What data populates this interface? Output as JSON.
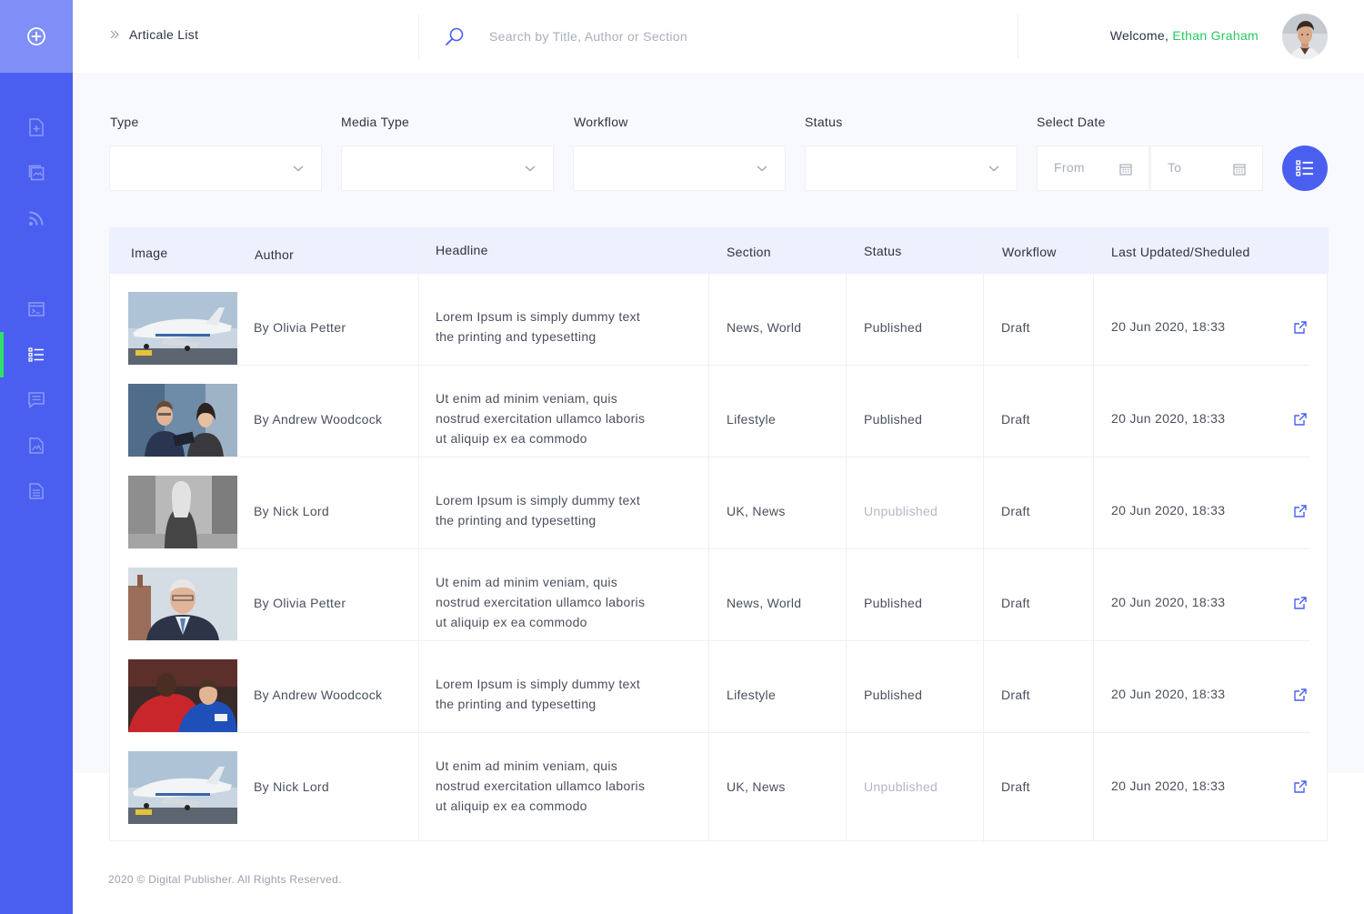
{
  "header": {
    "breadcrumb": "Articale List",
    "search_placeholder": "Search by Title, Author or Section",
    "welcome_prefix": "Welcome,",
    "user_name": "Ethan Graham"
  },
  "filters": {
    "type_label": "Type",
    "media_type_label": "Media Type",
    "workflow_label": "Workflow",
    "status_label": "Status",
    "date_label": "Select Date",
    "from_placeholder": "From",
    "to_placeholder": "To"
  },
  "table": {
    "columns": [
      "Image",
      "Author",
      "Headline",
      "Section",
      "Status",
      "Workflow",
      "Last Updated/Sheduled"
    ],
    "rows": [
      {
        "author": "By Olivia Petter",
        "headline": [
          "Lorem Ipsum is simply dummy text",
          "the printing and typesetting"
        ],
        "section": "News, World",
        "status": "Published",
        "workflow": "Draft",
        "updated": "20 Jun 2020, 18:33"
      },
      {
        "author": "By Andrew Woodcock",
        "headline": [
          "Ut enim ad minim veniam, quis",
          "nostrud exercitation ullamco laboris",
          "ut aliquip ex ea commodo"
        ],
        "section": "Lifestyle",
        "status": "Published",
        "workflow": "Draft",
        "updated": "20 Jun 2020, 18:33"
      },
      {
        "author": "By Nick Lord",
        "headline": [
          "Lorem Ipsum is simply dummy text",
          "the printing and typesetting"
        ],
        "section": "UK, News",
        "status": "Unpublished",
        "workflow": "Draft",
        "updated": "20 Jun 2020, 18:33"
      },
      {
        "author": "By Olivia Petter",
        "headline": [
          "Ut enim ad minim veniam, quis",
          "nostrud exercitation ullamco laboris",
          "ut aliquip ex ea commodo"
        ],
        "section": "News, World",
        "status": "Published",
        "workflow": "Draft",
        "updated": "20 Jun 2020, 18:33"
      },
      {
        "author": "By Andrew Woodcock",
        "headline": [
          "Lorem Ipsum is simply dummy text",
          "the printing and typesetting"
        ],
        "section": "Lifestyle",
        "status": "Published",
        "workflow": "Draft",
        "updated": "20 Jun 2020, 18:33"
      },
      {
        "author": "By Nick Lord",
        "headline": [
          "Ut enim ad minim veniam, quis",
          "nostrud exercitation ullamco laboris",
          "ut aliquip ex ea commodo"
        ],
        "section": "UK, News",
        "status": "Unpublished",
        "workflow": "Draft",
        "updated": "20 Jun 2020, 18:33"
      }
    ]
  },
  "footer": {
    "copyright": "2020 © Digital Publisher. All Rights Reserved."
  },
  "colors": {
    "primary": "#4a5ff0",
    "sidebar_top": "#7f8ff7",
    "accent_green": "#26c860",
    "header_row": "#edf0fd"
  },
  "icons": {
    "sidebar": [
      "add-circle-icon",
      "new-article-icon",
      "gallery-icon",
      "rss-icon",
      "terminal-icon",
      "list-icon",
      "comment-icon",
      "image-file-icon",
      "document-icon"
    ]
  }
}
